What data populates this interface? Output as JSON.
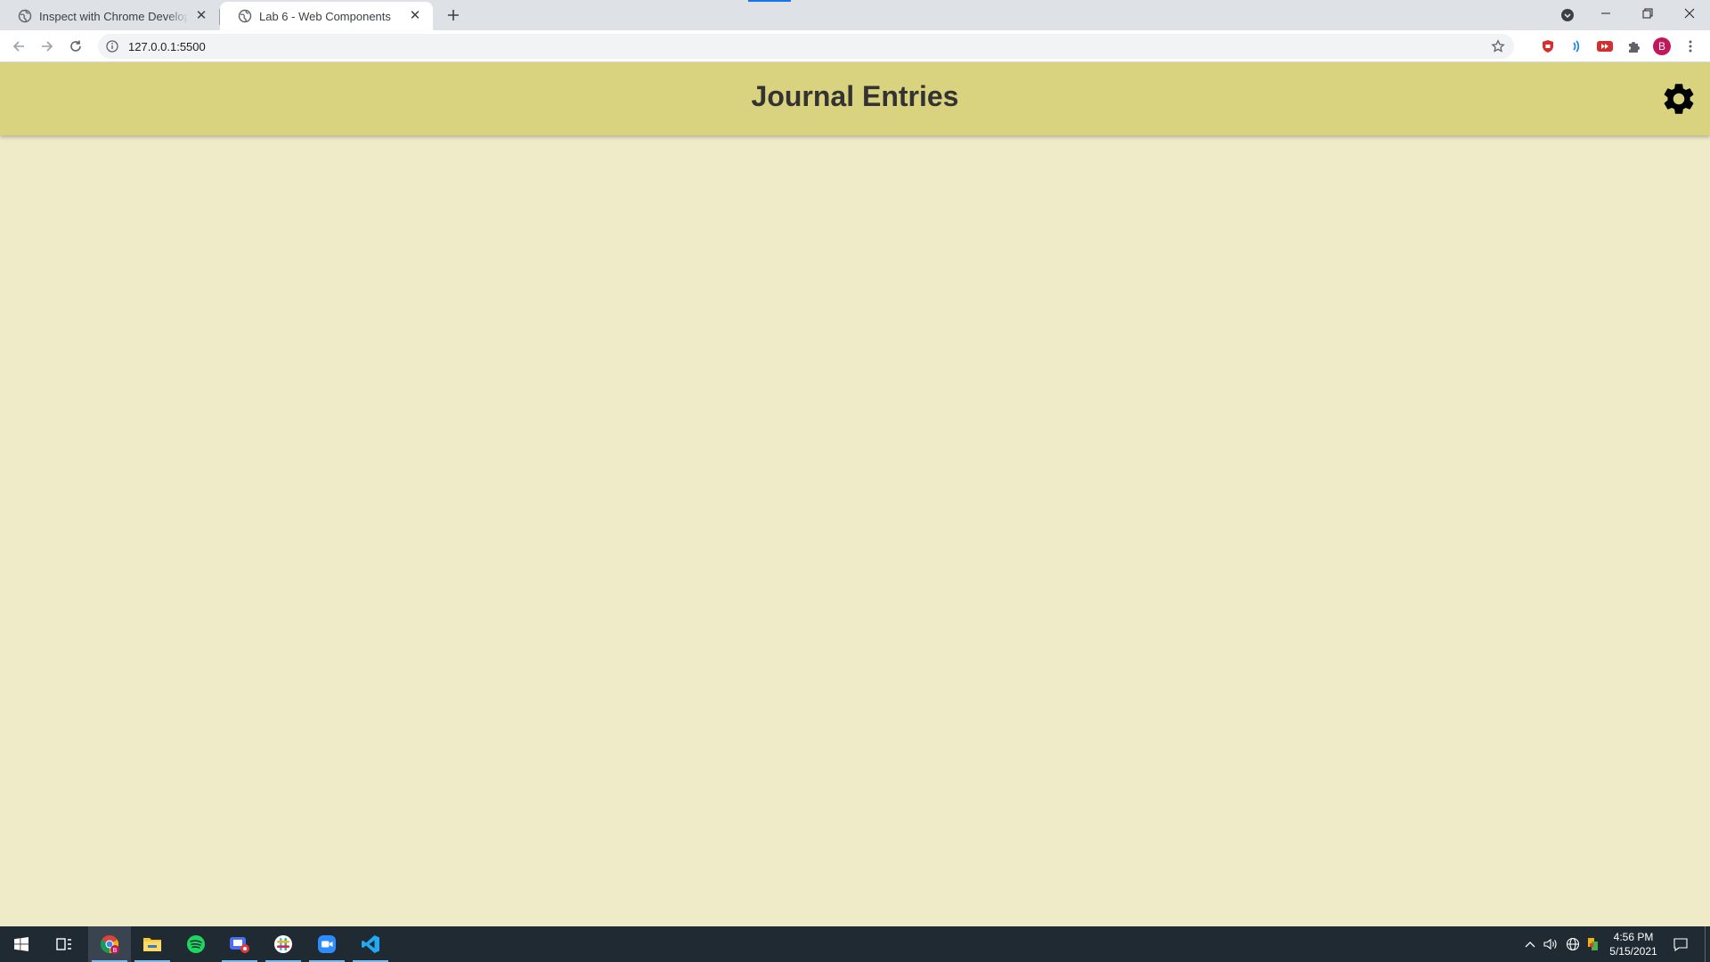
{
  "browser": {
    "tabs": [
      {
        "title": "Inspect with Chrome Developer Tools",
        "active": false
      },
      {
        "title": "Lab 6 - Web Components",
        "active": true
      }
    ],
    "close_glyph": "✕",
    "url": "127.0.0.1:5500",
    "profile_initial": "B"
  },
  "page": {
    "header_title": "Journal Entries",
    "header_color": "#d9d27f",
    "background_color": "#efeac8",
    "settings_icon": "gear-icon"
  },
  "taskbar": {
    "apps": [
      "chrome-icon",
      "file-explorer-icon",
      "spotify-icon",
      "recorder-icon",
      "slack-icon",
      "zoom-icon",
      "vscode-icon"
    ],
    "chrome_badge": "B",
    "time": "4:56 PM",
    "date": "5/15/2021"
  }
}
